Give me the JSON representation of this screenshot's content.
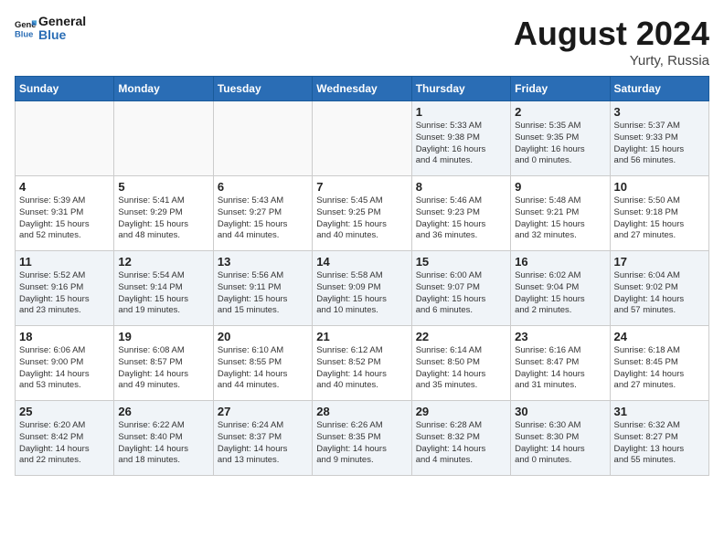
{
  "header": {
    "logo_line1": "General",
    "logo_line2": "Blue",
    "month_year": "August 2024",
    "location": "Yurty, Russia"
  },
  "weekdays": [
    "Sunday",
    "Monday",
    "Tuesday",
    "Wednesday",
    "Thursday",
    "Friday",
    "Saturday"
  ],
  "weeks": [
    [
      {
        "day": "",
        "lines": []
      },
      {
        "day": "",
        "lines": []
      },
      {
        "day": "",
        "lines": []
      },
      {
        "day": "",
        "lines": []
      },
      {
        "day": "1",
        "lines": [
          "Sunrise: 5:33 AM",
          "Sunset: 9:38 PM",
          "Daylight: 16 hours",
          "and 4 minutes."
        ]
      },
      {
        "day": "2",
        "lines": [
          "Sunrise: 5:35 AM",
          "Sunset: 9:35 PM",
          "Daylight: 16 hours",
          "and 0 minutes."
        ]
      },
      {
        "day": "3",
        "lines": [
          "Sunrise: 5:37 AM",
          "Sunset: 9:33 PM",
          "Daylight: 15 hours",
          "and 56 minutes."
        ]
      }
    ],
    [
      {
        "day": "4",
        "lines": [
          "Sunrise: 5:39 AM",
          "Sunset: 9:31 PM",
          "Daylight: 15 hours",
          "and 52 minutes."
        ]
      },
      {
        "day": "5",
        "lines": [
          "Sunrise: 5:41 AM",
          "Sunset: 9:29 PM",
          "Daylight: 15 hours",
          "and 48 minutes."
        ]
      },
      {
        "day": "6",
        "lines": [
          "Sunrise: 5:43 AM",
          "Sunset: 9:27 PM",
          "Daylight: 15 hours",
          "and 44 minutes."
        ]
      },
      {
        "day": "7",
        "lines": [
          "Sunrise: 5:45 AM",
          "Sunset: 9:25 PM",
          "Daylight: 15 hours",
          "and 40 minutes."
        ]
      },
      {
        "day": "8",
        "lines": [
          "Sunrise: 5:46 AM",
          "Sunset: 9:23 PM",
          "Daylight: 15 hours",
          "and 36 minutes."
        ]
      },
      {
        "day": "9",
        "lines": [
          "Sunrise: 5:48 AM",
          "Sunset: 9:21 PM",
          "Daylight: 15 hours",
          "and 32 minutes."
        ]
      },
      {
        "day": "10",
        "lines": [
          "Sunrise: 5:50 AM",
          "Sunset: 9:18 PM",
          "Daylight: 15 hours",
          "and 27 minutes."
        ]
      }
    ],
    [
      {
        "day": "11",
        "lines": [
          "Sunrise: 5:52 AM",
          "Sunset: 9:16 PM",
          "Daylight: 15 hours",
          "and 23 minutes."
        ]
      },
      {
        "day": "12",
        "lines": [
          "Sunrise: 5:54 AM",
          "Sunset: 9:14 PM",
          "Daylight: 15 hours",
          "and 19 minutes."
        ]
      },
      {
        "day": "13",
        "lines": [
          "Sunrise: 5:56 AM",
          "Sunset: 9:11 PM",
          "Daylight: 15 hours",
          "and 15 minutes."
        ]
      },
      {
        "day": "14",
        "lines": [
          "Sunrise: 5:58 AM",
          "Sunset: 9:09 PM",
          "Daylight: 15 hours",
          "and 10 minutes."
        ]
      },
      {
        "day": "15",
        "lines": [
          "Sunrise: 6:00 AM",
          "Sunset: 9:07 PM",
          "Daylight: 15 hours",
          "and 6 minutes."
        ]
      },
      {
        "day": "16",
        "lines": [
          "Sunrise: 6:02 AM",
          "Sunset: 9:04 PM",
          "Daylight: 15 hours",
          "and 2 minutes."
        ]
      },
      {
        "day": "17",
        "lines": [
          "Sunrise: 6:04 AM",
          "Sunset: 9:02 PM",
          "Daylight: 14 hours",
          "and 57 minutes."
        ]
      }
    ],
    [
      {
        "day": "18",
        "lines": [
          "Sunrise: 6:06 AM",
          "Sunset: 9:00 PM",
          "Daylight: 14 hours",
          "and 53 minutes."
        ]
      },
      {
        "day": "19",
        "lines": [
          "Sunrise: 6:08 AM",
          "Sunset: 8:57 PM",
          "Daylight: 14 hours",
          "and 49 minutes."
        ]
      },
      {
        "day": "20",
        "lines": [
          "Sunrise: 6:10 AM",
          "Sunset: 8:55 PM",
          "Daylight: 14 hours",
          "and 44 minutes."
        ]
      },
      {
        "day": "21",
        "lines": [
          "Sunrise: 6:12 AM",
          "Sunset: 8:52 PM",
          "Daylight: 14 hours",
          "and 40 minutes."
        ]
      },
      {
        "day": "22",
        "lines": [
          "Sunrise: 6:14 AM",
          "Sunset: 8:50 PM",
          "Daylight: 14 hours",
          "and 35 minutes."
        ]
      },
      {
        "day": "23",
        "lines": [
          "Sunrise: 6:16 AM",
          "Sunset: 8:47 PM",
          "Daylight: 14 hours",
          "and 31 minutes."
        ]
      },
      {
        "day": "24",
        "lines": [
          "Sunrise: 6:18 AM",
          "Sunset: 8:45 PM",
          "Daylight: 14 hours",
          "and 27 minutes."
        ]
      }
    ],
    [
      {
        "day": "25",
        "lines": [
          "Sunrise: 6:20 AM",
          "Sunset: 8:42 PM",
          "Daylight: 14 hours",
          "and 22 minutes."
        ]
      },
      {
        "day": "26",
        "lines": [
          "Sunrise: 6:22 AM",
          "Sunset: 8:40 PM",
          "Daylight: 14 hours",
          "and 18 minutes."
        ]
      },
      {
        "day": "27",
        "lines": [
          "Sunrise: 6:24 AM",
          "Sunset: 8:37 PM",
          "Daylight: 14 hours",
          "and 13 minutes."
        ]
      },
      {
        "day": "28",
        "lines": [
          "Sunrise: 6:26 AM",
          "Sunset: 8:35 PM",
          "Daylight: 14 hours",
          "and 9 minutes."
        ]
      },
      {
        "day": "29",
        "lines": [
          "Sunrise: 6:28 AM",
          "Sunset: 8:32 PM",
          "Daylight: 14 hours",
          "and 4 minutes."
        ]
      },
      {
        "day": "30",
        "lines": [
          "Sunrise: 6:30 AM",
          "Sunset: 8:30 PM",
          "Daylight: 14 hours",
          "and 0 minutes."
        ]
      },
      {
        "day": "31",
        "lines": [
          "Sunrise: 6:32 AM",
          "Sunset: 8:27 PM",
          "Daylight: 13 hours",
          "and 55 minutes."
        ]
      }
    ]
  ]
}
